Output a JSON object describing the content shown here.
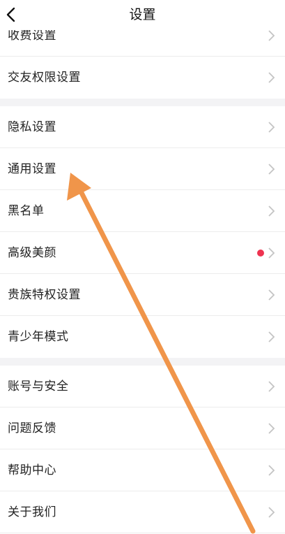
{
  "header": {
    "title": "设置"
  },
  "groups": [
    {
      "items": [
        {
          "label": "收费设置"
        },
        {
          "label": "交友权限设置"
        }
      ]
    },
    {
      "items": [
        {
          "label": "隐私设置"
        },
        {
          "label": "通用设置"
        },
        {
          "label": "黑名单"
        },
        {
          "label": "高级美颜",
          "badge": "red-dot"
        },
        {
          "label": "贵族特权设置"
        },
        {
          "label": "青少年模式"
        }
      ]
    },
    {
      "items": [
        {
          "label": "账号与安全"
        },
        {
          "label": "问题反馈"
        },
        {
          "label": "帮助中心"
        },
        {
          "label": "关于我们"
        }
      ]
    }
  ],
  "icons": {
    "back": "back-chevron-icon",
    "row": "chevron-right-icon",
    "annotation": "orange-arrow"
  },
  "colors": {
    "badge": "#ee3350",
    "annotation_arrow": "#f0954a",
    "chevron": "#c4c4c4",
    "group_gap": "#f3f3f5"
  }
}
